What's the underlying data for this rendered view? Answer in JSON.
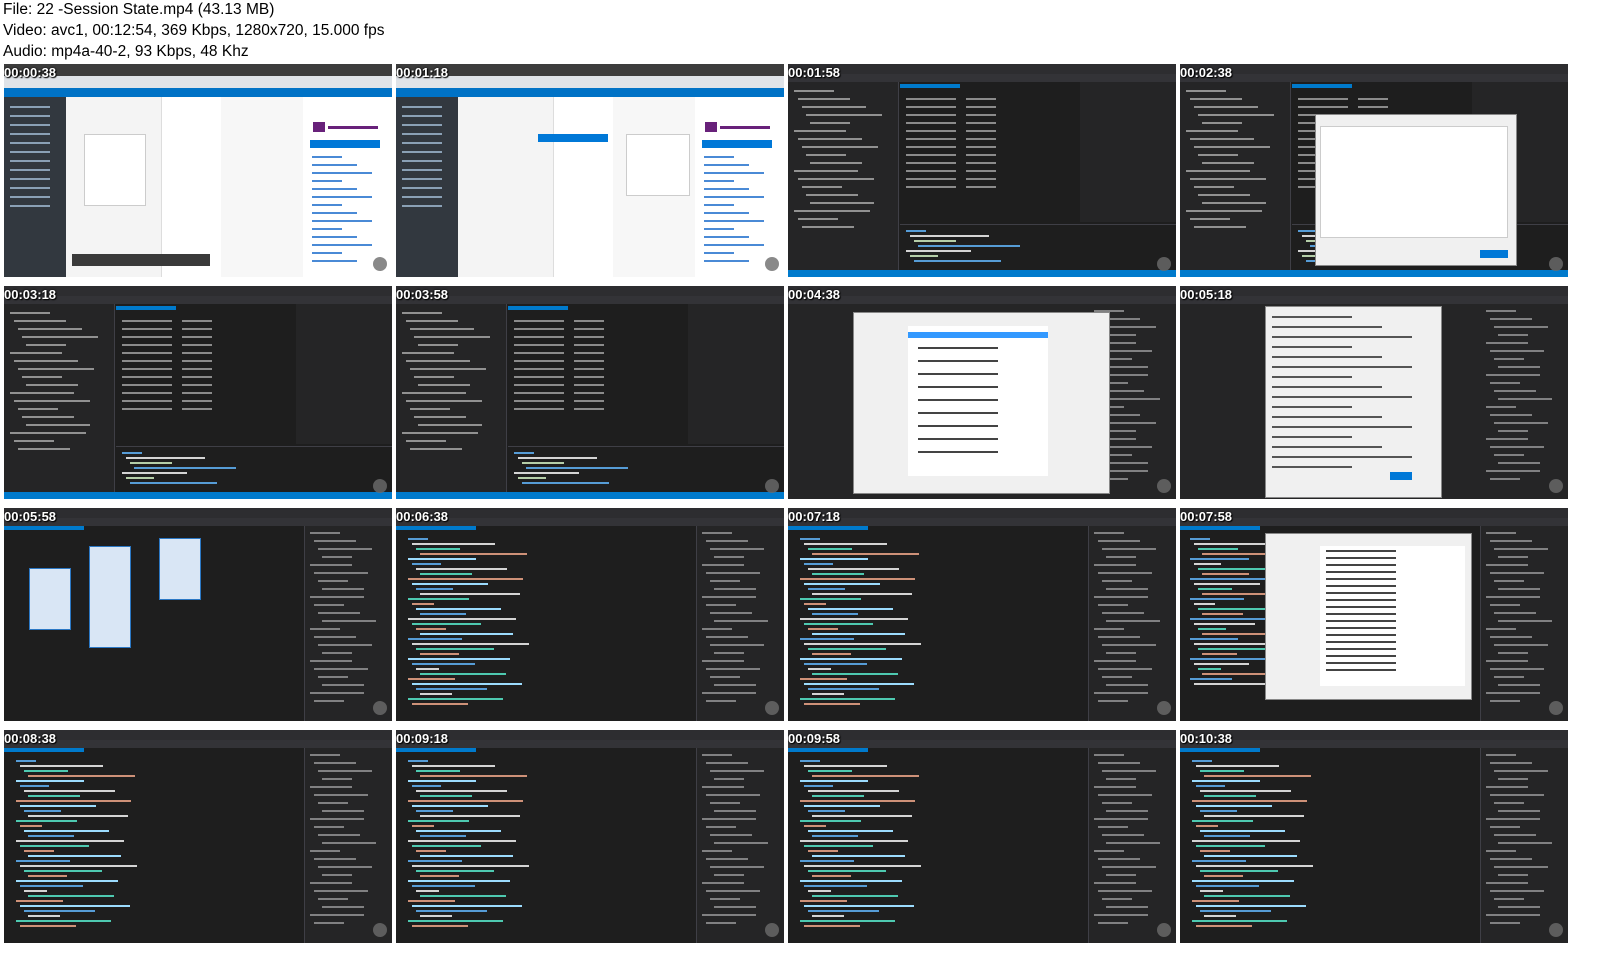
{
  "header": {
    "file_line": "File: 22 -Session State.mp4 (43.13 MB)",
    "video_line": "Video: avc1, 00:12:54, 369 Kbps, 1280x720, 15.000 fps",
    "audio_line": "Audio: mp4a-40-2, 93 Kbps, 48 Khz"
  },
  "thumbnails": [
    {
      "timestamp": "00:00:38",
      "kind": "azure"
    },
    {
      "timestamp": "00:01:18",
      "kind": "azure2"
    },
    {
      "timestamp": "00:01:58",
      "kind": "vs-sql"
    },
    {
      "timestamp": "00:02:38",
      "kind": "vs-dialog"
    },
    {
      "timestamp": "00:03:18",
      "kind": "vs-table"
    },
    {
      "timestamp": "00:03:58",
      "kind": "vs-table"
    },
    {
      "timestamp": "00:04:38",
      "kind": "vs-newitem"
    },
    {
      "timestamp": "00:05:18",
      "kind": "vs-conn"
    },
    {
      "timestamp": "00:05:58",
      "kind": "vs-edmx"
    },
    {
      "timestamp": "00:06:38",
      "kind": "vs-code"
    },
    {
      "timestamp": "00:07:18",
      "kind": "vs-code"
    },
    {
      "timestamp": "00:07:58",
      "kind": "vs-ref"
    },
    {
      "timestamp": "00:08:38",
      "kind": "vs-code"
    },
    {
      "timestamp": "00:09:18",
      "kind": "vs-code"
    },
    {
      "timestamp": "00:09:58",
      "kind": "vs-code"
    },
    {
      "timestamp": "00:10:38",
      "kind": "vs-code"
    }
  ]
}
